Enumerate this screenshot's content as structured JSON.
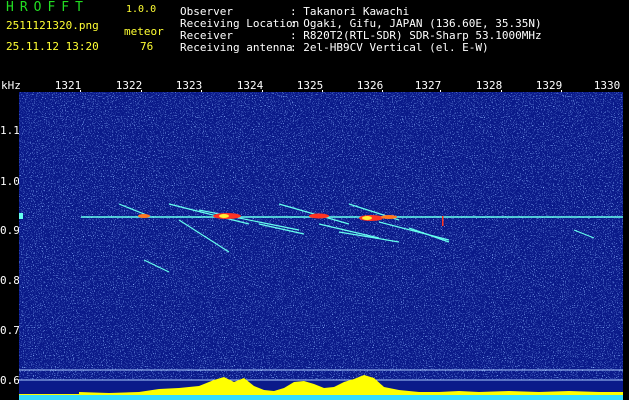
{
  "header": {
    "brand": "HROFFT",
    "version": "1.0.0",
    "filename": "2511121320.png",
    "datetime": "25.11.12 13:20",
    "meteor_label": "meteor",
    "meteor_count": "76",
    "info": [
      {
        "label": "Observer",
        "value": ": Takanori Kawachi"
      },
      {
        "label": "Receiving Location",
        "value": ": Ogaki, Gifu, JAPAN (136.60E, 35.35N)"
      },
      {
        "label": "Receiver",
        "value": ": R820T2(RTL-SDR) SDR-Sharp 53.1000MHz"
      },
      {
        "label": "Receiving antenna",
        "value": ": 2el-HB9CV Vertical (el. E-W)"
      }
    ]
  },
  "axis": {
    "unit": "kHz",
    "time_ticks": [
      "1321",
      "1322",
      "1323",
      "1324",
      "1325",
      "1326",
      "1327",
      "1328",
      "1329",
      "1330"
    ],
    "freq_ticks": [
      "1.1",
      "1.0",
      "0.9",
      "0.8",
      "0.7",
      "0.6"
    ]
  },
  "colors": {
    "background": "#000000",
    "spectrum_bg": "#0a1a8a",
    "trace": "#66ffee",
    "hot": "#ff3322",
    "level_bar": "#ffff00",
    "brand": "#22dd22",
    "accent": "#ffff33"
  }
}
